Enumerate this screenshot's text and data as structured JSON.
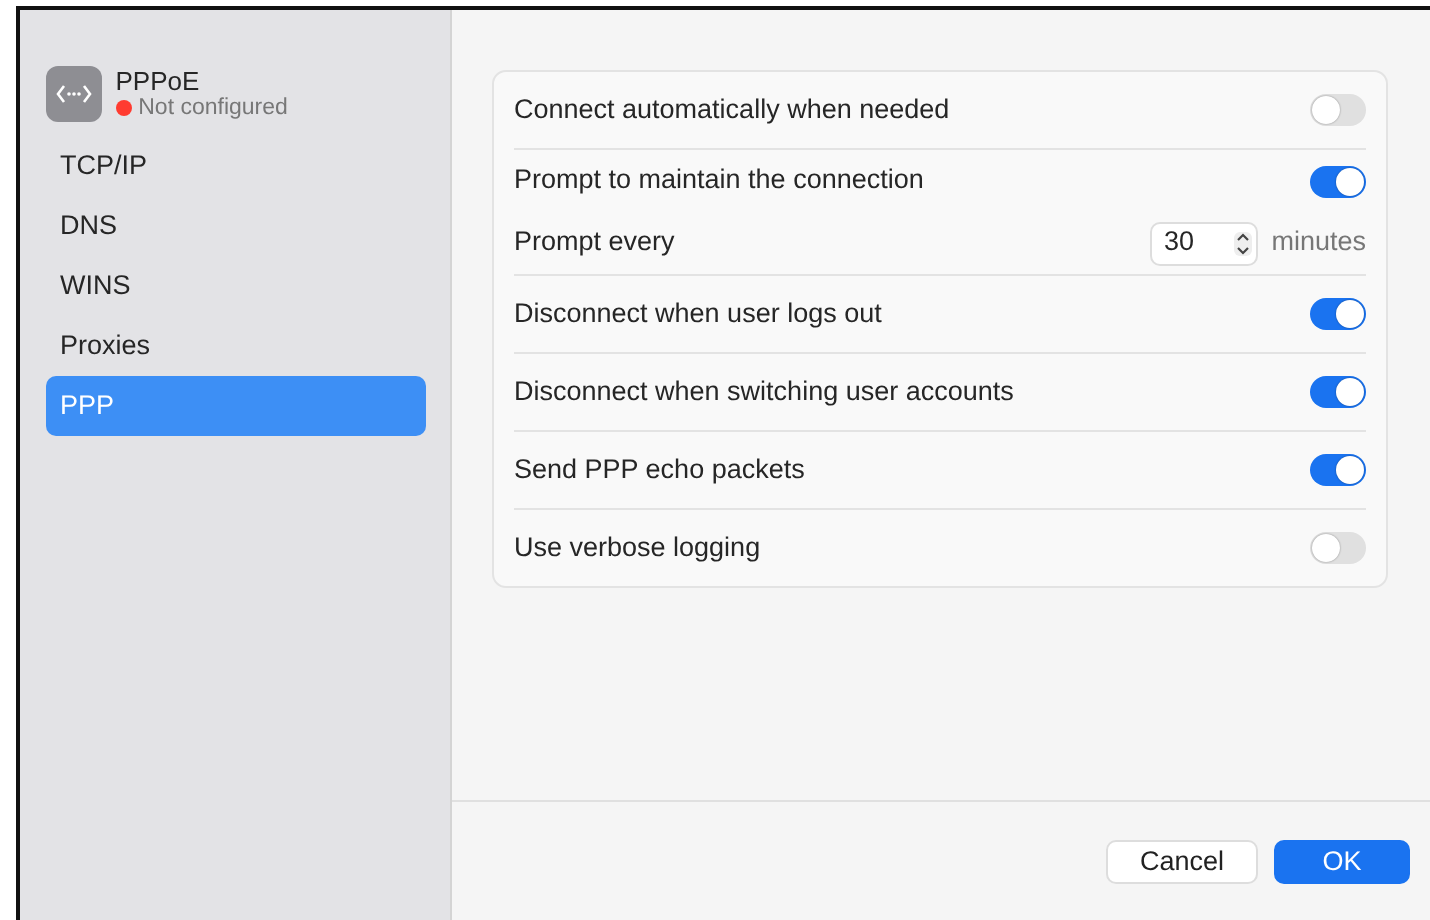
{
  "sidebar": {
    "title": "PPPoE",
    "status": {
      "text": "Not configured",
      "color": "#ff3b30"
    },
    "items": [
      {
        "label": "TCP/IP",
        "selected": false
      },
      {
        "label": "DNS",
        "selected": false
      },
      {
        "label": "WINS",
        "selected": false
      },
      {
        "label": "Proxies",
        "selected": false
      },
      {
        "label": "PPP",
        "selected": true
      }
    ]
  },
  "groups": [
    [
      {
        "kind": "toggle",
        "label": "Connect automatically when needed",
        "on": false
      }
    ],
    [
      {
        "kind": "toggle",
        "label": "Prompt to maintain the connection",
        "on": true
      },
      {
        "kind": "stepper",
        "label": "Prompt every",
        "value": "30",
        "unit": "minutes"
      }
    ],
    [
      {
        "kind": "toggle",
        "label": "Disconnect when user logs out",
        "on": true
      }
    ],
    [
      {
        "kind": "toggle",
        "label": "Disconnect when switching user accounts",
        "on": true
      }
    ],
    [
      {
        "kind": "toggle",
        "label": "Send PPP echo packets",
        "on": true
      }
    ],
    [
      {
        "kind": "toggle",
        "label": "Use verbose logging",
        "on": false
      }
    ]
  ],
  "buttons": [
    {
      "label": "Cancel",
      "kind": "default"
    },
    {
      "label": "OK",
      "kind": "primary"
    }
  ]
}
